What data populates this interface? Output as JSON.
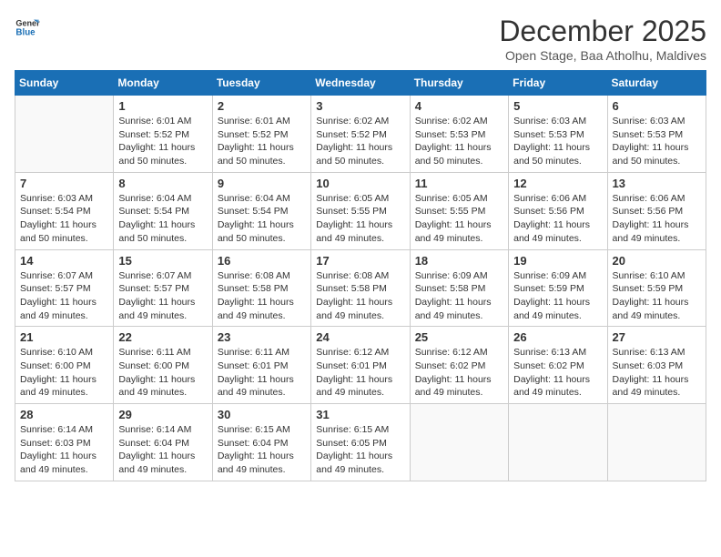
{
  "logo": {
    "line1": "General",
    "line2": "Blue"
  },
  "title": "December 2025",
  "subtitle": "Open Stage, Baa Atholhu, Maldives",
  "days_header": [
    "Sunday",
    "Monday",
    "Tuesday",
    "Wednesday",
    "Thursday",
    "Friday",
    "Saturday"
  ],
  "weeks": [
    [
      {
        "num": "",
        "info": ""
      },
      {
        "num": "1",
        "info": "Sunrise: 6:01 AM\nSunset: 5:52 PM\nDaylight: 11 hours\nand 50 minutes."
      },
      {
        "num": "2",
        "info": "Sunrise: 6:01 AM\nSunset: 5:52 PM\nDaylight: 11 hours\nand 50 minutes."
      },
      {
        "num": "3",
        "info": "Sunrise: 6:02 AM\nSunset: 5:52 PM\nDaylight: 11 hours\nand 50 minutes."
      },
      {
        "num": "4",
        "info": "Sunrise: 6:02 AM\nSunset: 5:53 PM\nDaylight: 11 hours\nand 50 minutes."
      },
      {
        "num": "5",
        "info": "Sunrise: 6:03 AM\nSunset: 5:53 PM\nDaylight: 11 hours\nand 50 minutes."
      },
      {
        "num": "6",
        "info": "Sunrise: 6:03 AM\nSunset: 5:53 PM\nDaylight: 11 hours\nand 50 minutes."
      }
    ],
    [
      {
        "num": "7",
        "info": "Sunrise: 6:03 AM\nSunset: 5:54 PM\nDaylight: 11 hours\nand 50 minutes."
      },
      {
        "num": "8",
        "info": "Sunrise: 6:04 AM\nSunset: 5:54 PM\nDaylight: 11 hours\nand 50 minutes."
      },
      {
        "num": "9",
        "info": "Sunrise: 6:04 AM\nSunset: 5:54 PM\nDaylight: 11 hours\nand 50 minutes."
      },
      {
        "num": "10",
        "info": "Sunrise: 6:05 AM\nSunset: 5:55 PM\nDaylight: 11 hours\nand 49 minutes."
      },
      {
        "num": "11",
        "info": "Sunrise: 6:05 AM\nSunset: 5:55 PM\nDaylight: 11 hours\nand 49 minutes."
      },
      {
        "num": "12",
        "info": "Sunrise: 6:06 AM\nSunset: 5:56 PM\nDaylight: 11 hours\nand 49 minutes."
      },
      {
        "num": "13",
        "info": "Sunrise: 6:06 AM\nSunset: 5:56 PM\nDaylight: 11 hours\nand 49 minutes."
      }
    ],
    [
      {
        "num": "14",
        "info": "Sunrise: 6:07 AM\nSunset: 5:57 PM\nDaylight: 11 hours\nand 49 minutes."
      },
      {
        "num": "15",
        "info": "Sunrise: 6:07 AM\nSunset: 5:57 PM\nDaylight: 11 hours\nand 49 minutes."
      },
      {
        "num": "16",
        "info": "Sunrise: 6:08 AM\nSunset: 5:58 PM\nDaylight: 11 hours\nand 49 minutes."
      },
      {
        "num": "17",
        "info": "Sunrise: 6:08 AM\nSunset: 5:58 PM\nDaylight: 11 hours\nand 49 minutes."
      },
      {
        "num": "18",
        "info": "Sunrise: 6:09 AM\nSunset: 5:58 PM\nDaylight: 11 hours\nand 49 minutes."
      },
      {
        "num": "19",
        "info": "Sunrise: 6:09 AM\nSunset: 5:59 PM\nDaylight: 11 hours\nand 49 minutes."
      },
      {
        "num": "20",
        "info": "Sunrise: 6:10 AM\nSunset: 5:59 PM\nDaylight: 11 hours\nand 49 minutes."
      }
    ],
    [
      {
        "num": "21",
        "info": "Sunrise: 6:10 AM\nSunset: 6:00 PM\nDaylight: 11 hours\nand 49 minutes."
      },
      {
        "num": "22",
        "info": "Sunrise: 6:11 AM\nSunset: 6:00 PM\nDaylight: 11 hours\nand 49 minutes."
      },
      {
        "num": "23",
        "info": "Sunrise: 6:11 AM\nSunset: 6:01 PM\nDaylight: 11 hours\nand 49 minutes."
      },
      {
        "num": "24",
        "info": "Sunrise: 6:12 AM\nSunset: 6:01 PM\nDaylight: 11 hours\nand 49 minutes."
      },
      {
        "num": "25",
        "info": "Sunrise: 6:12 AM\nSunset: 6:02 PM\nDaylight: 11 hours\nand 49 minutes."
      },
      {
        "num": "26",
        "info": "Sunrise: 6:13 AM\nSunset: 6:02 PM\nDaylight: 11 hours\nand 49 minutes."
      },
      {
        "num": "27",
        "info": "Sunrise: 6:13 AM\nSunset: 6:03 PM\nDaylight: 11 hours\nand 49 minutes."
      }
    ],
    [
      {
        "num": "28",
        "info": "Sunrise: 6:14 AM\nSunset: 6:03 PM\nDaylight: 11 hours\nand 49 minutes."
      },
      {
        "num": "29",
        "info": "Sunrise: 6:14 AM\nSunset: 6:04 PM\nDaylight: 11 hours\nand 49 minutes."
      },
      {
        "num": "30",
        "info": "Sunrise: 6:15 AM\nSunset: 6:04 PM\nDaylight: 11 hours\nand 49 minutes."
      },
      {
        "num": "31",
        "info": "Sunrise: 6:15 AM\nSunset: 6:05 PM\nDaylight: 11 hours\nand 49 minutes."
      },
      {
        "num": "",
        "info": ""
      },
      {
        "num": "",
        "info": ""
      },
      {
        "num": "",
        "info": ""
      }
    ]
  ]
}
